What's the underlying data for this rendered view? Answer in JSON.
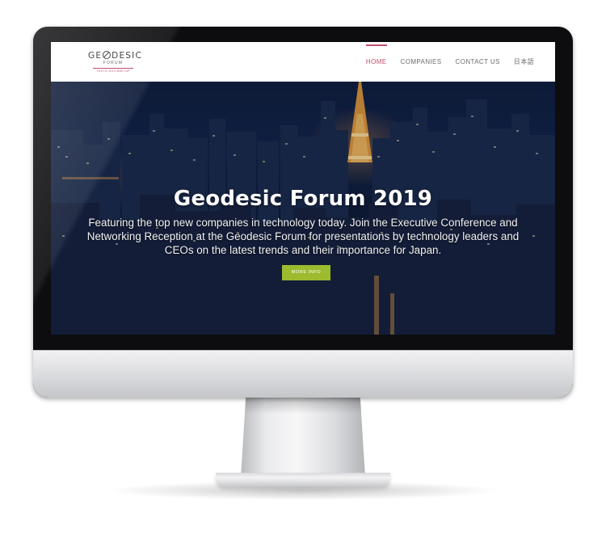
{
  "logo": {
    "name_pre": "GE",
    "name_post": "DESIC",
    "sub": "FORUM",
    "tagline": "TOKYO 2019 MEETUP"
  },
  "nav": {
    "items": [
      {
        "label": "HOME",
        "active": true
      },
      {
        "label": "COMPANIES",
        "active": false
      },
      {
        "label": "CONTACT US",
        "active": false
      },
      {
        "label": "日本語",
        "active": false
      }
    ]
  },
  "hero": {
    "title": "Geodesic Forum 2019",
    "description": "Featuring the top new companies in technology today. Join the Executive Conference and Networking Reception at the Geodesic Forum for presentations by technology leaders and CEOs on the latest trends and their importance for Japan.",
    "button_label": "MORE INFO"
  },
  "colors": {
    "accent": "#c0506f",
    "button": "#9cbb2e",
    "hero_bg": "#0f1e3e"
  }
}
